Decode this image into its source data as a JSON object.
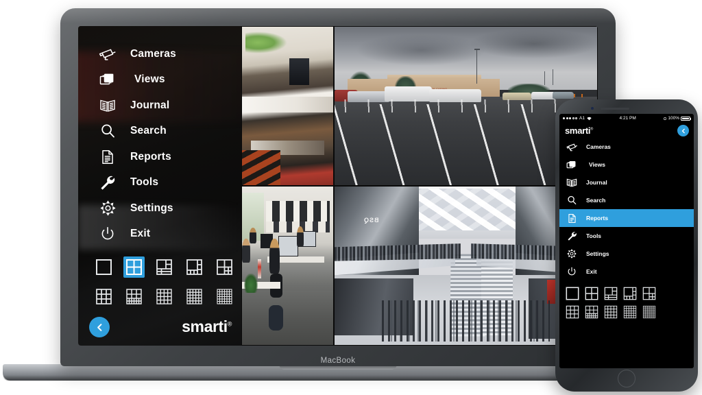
{
  "brand": {
    "name": "smarti",
    "trademark": "®",
    "accent": "#2f9fdd"
  },
  "laptop": {
    "device_label": "MacBook",
    "sidebar": {
      "menu": [
        {
          "label": "Cameras",
          "icon": "cctv-camera-icon"
        },
        {
          "label": "Views",
          "icon": "layers-icon"
        },
        {
          "label": "Journal",
          "icon": "open-book-icon"
        },
        {
          "label": "Search",
          "icon": "magnifier-icon"
        },
        {
          "label": "Reports",
          "icon": "document-icon"
        },
        {
          "label": "Tools",
          "icon": "wrench-icon"
        },
        {
          "label": "Settings",
          "icon": "gear-icon"
        },
        {
          "label": "Exit",
          "icon": "power-icon"
        }
      ],
      "layouts": [
        {
          "name": "layout-1x1",
          "cells": 1,
          "selected": false
        },
        {
          "name": "layout-2x2",
          "cells": 4,
          "selected": true
        },
        {
          "name": "layout-1plus5",
          "cells": 6,
          "selected": false
        },
        {
          "name": "layout-1plus7",
          "cells": 8,
          "selected": false
        },
        {
          "name": "layout-2plus4",
          "cells": 6,
          "selected": false
        },
        {
          "name": "layout-3x3",
          "cells": 9,
          "selected": false
        },
        {
          "name": "layout-3plus8",
          "cells": 12,
          "selected": false
        },
        {
          "name": "layout-4x4-mixed",
          "cells": 13,
          "selected": false
        },
        {
          "name": "layout-4x4",
          "cells": 16,
          "selected": false
        },
        {
          "name": "layout-6x6",
          "cells": 36,
          "selected": false
        }
      ],
      "back_button": "back-chevron-icon",
      "logo": "smarti"
    },
    "video_wall": {
      "tiles": [
        {
          "name": "camera-tile-mall-upper-level",
          "scene": "Mall upper level walkway with storefronts"
        },
        {
          "name": "camera-tile-parking-lot",
          "scene": "Parking lot with parked cars and building"
        },
        {
          "name": "camera-tile-office",
          "scene": "Open plan office with staff at desks"
        },
        {
          "name": "camera-tile-mall-atrium",
          "scene": "Busy mall atrium with escalators and shoppers"
        }
      ]
    }
  },
  "phone": {
    "status_bar": {
      "carrier": "A1",
      "time": "4:21 PM",
      "battery": "100%"
    },
    "header": {
      "logo": "smarti",
      "back_button": "back-chevron-icon"
    },
    "menu": [
      {
        "label": "Cameras",
        "icon": "cctv-camera-icon",
        "active": false
      },
      {
        "label": "Views",
        "icon": "layers-icon",
        "active": false
      },
      {
        "label": "Journal",
        "icon": "open-book-icon",
        "active": false
      },
      {
        "label": "Search",
        "icon": "magnifier-icon",
        "active": false
      },
      {
        "label": "Reports",
        "icon": "document-icon",
        "active": true
      },
      {
        "label": "Tools",
        "icon": "wrench-icon",
        "active": false
      },
      {
        "label": "Settings",
        "icon": "gear-icon",
        "active": false
      },
      {
        "label": "Exit",
        "icon": "power-icon",
        "active": false
      }
    ],
    "layouts": [
      {
        "name": "layout-1x1",
        "cells": 1,
        "selected": false
      },
      {
        "name": "layout-2x2",
        "cells": 4,
        "selected": false
      },
      {
        "name": "layout-1plus5",
        "cells": 6,
        "selected": false
      },
      {
        "name": "layout-1plus7",
        "cells": 8,
        "selected": false
      },
      {
        "name": "layout-2plus4",
        "cells": 6,
        "selected": false
      },
      {
        "name": "layout-3x3",
        "cells": 9,
        "selected": false
      },
      {
        "name": "layout-3plus8",
        "cells": 12,
        "selected": false
      },
      {
        "name": "layout-4x4-mixed",
        "cells": 13,
        "selected": false
      },
      {
        "name": "layout-4x4",
        "cells": 16,
        "selected": false
      },
      {
        "name": "layout-6x6",
        "cells": 36,
        "selected": false
      }
    ]
  },
  "parking_sign_text": "CASL ROCK CASINO"
}
